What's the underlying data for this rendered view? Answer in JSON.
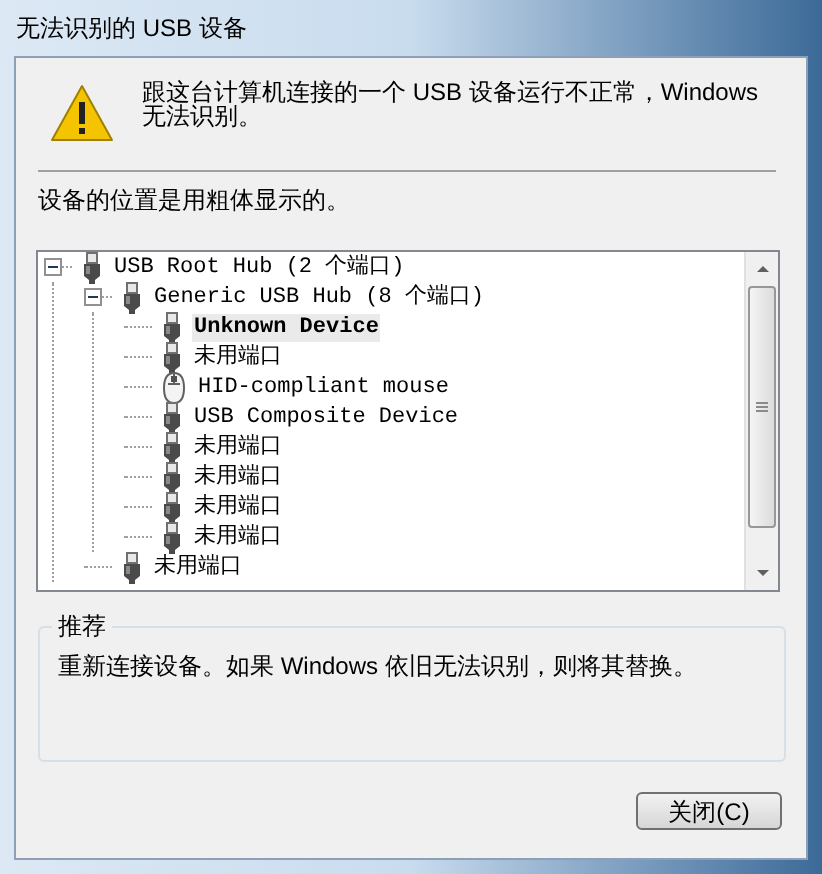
{
  "window": {
    "title": "无法识别的 USB 设备"
  },
  "message": "跟这台计算机连接的一个 USB 设备运行不正常，Windows 无法识别。",
  "hint": "设备的位置是用粗体显示的。",
  "tree": [
    {
      "label": "USB Root Hub (2 个端口)",
      "kind": "usb",
      "expanded": true,
      "children": [
        {
          "label": "Generic USB Hub (8 个端口)",
          "kind": "usb",
          "expanded": true,
          "children": [
            {
              "label": "Unknown Device",
              "kind": "usb",
              "bold": true
            },
            {
              "label": "未用端口",
              "kind": "usb",
              "bold": false
            },
            {
              "label": "HID-compliant mouse",
              "kind": "mouse",
              "bold": false
            },
            {
              "label": "USB Composite Device",
              "kind": "usb",
              "bold": false
            },
            {
              "label": "未用端口",
              "kind": "usb",
              "bold": false
            },
            {
              "label": "未用端口",
              "kind": "usb",
              "bold": false
            },
            {
              "label": "未用端口",
              "kind": "usb",
              "bold": false
            },
            {
              "label": "未用端口",
              "kind": "usb",
              "bold": false
            }
          ]
        },
        {
          "label": "未用端口",
          "kind": "usb",
          "bold": false
        }
      ]
    }
  ],
  "recommendation": {
    "title": "推荐",
    "text": "重新连接设备。如果 Windows 依旧无法识别，则将其替换。"
  },
  "buttons": [
    {
      "label": "关闭(C)"
    }
  ]
}
